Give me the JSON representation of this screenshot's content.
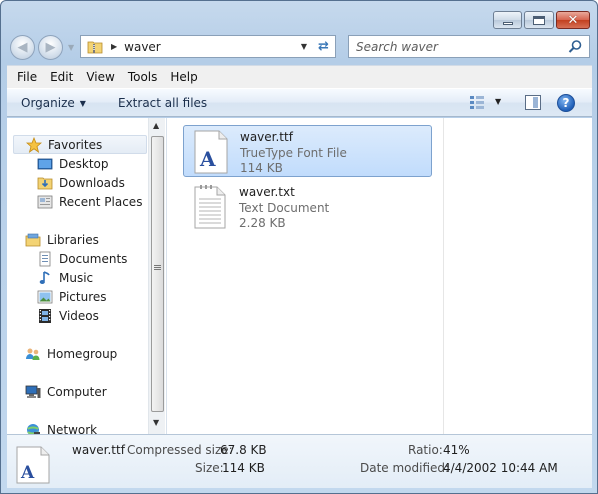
{
  "window": {
    "title": ""
  },
  "titlebar": {
    "minimize_icon": "minimize-icon",
    "maximize_icon": "maximize-icon",
    "close_icon": "close-icon",
    "close_glyph": "✕"
  },
  "nav": {
    "back_glyph": "◀",
    "forward_glyph": "▶",
    "address": {
      "segment": "waver"
    },
    "search": {
      "placeholder": "Search waver"
    }
  },
  "menu": [
    "File",
    "Edit",
    "View",
    "Tools",
    "Help"
  ],
  "toolbar": {
    "organize": "Organize",
    "extract": "Extract all files",
    "help_glyph": "?"
  },
  "sidebar": {
    "favorites": {
      "label": "Favorites",
      "items": [
        "Desktop",
        "Downloads",
        "Recent Places"
      ]
    },
    "libraries": {
      "label": "Libraries",
      "items": [
        "Documents",
        "Music",
        "Pictures",
        "Videos"
      ]
    },
    "homegroup": "Homegroup",
    "computer": "Computer",
    "network": "Network"
  },
  "files": [
    {
      "name": "waver.ttf",
      "type": "TrueType Font File",
      "size": "114 KB",
      "selected": true
    },
    {
      "name": "waver.txt",
      "type": "Text Document",
      "size": "2.28 KB",
      "selected": false
    }
  ],
  "details": {
    "name": "waver.ttf",
    "compressed_label": "Compressed size:",
    "compressed_value": "67.8 KB",
    "size_label": "Size:",
    "size_value": "114 KB",
    "ratio_label": "Ratio:",
    "ratio_value": "41%",
    "modified_label": "Date modified:",
    "modified_value": "4/4/2002 10:44 AM"
  },
  "colors": {
    "selection": "#cce4fc",
    "accent": "#1d4f99"
  }
}
